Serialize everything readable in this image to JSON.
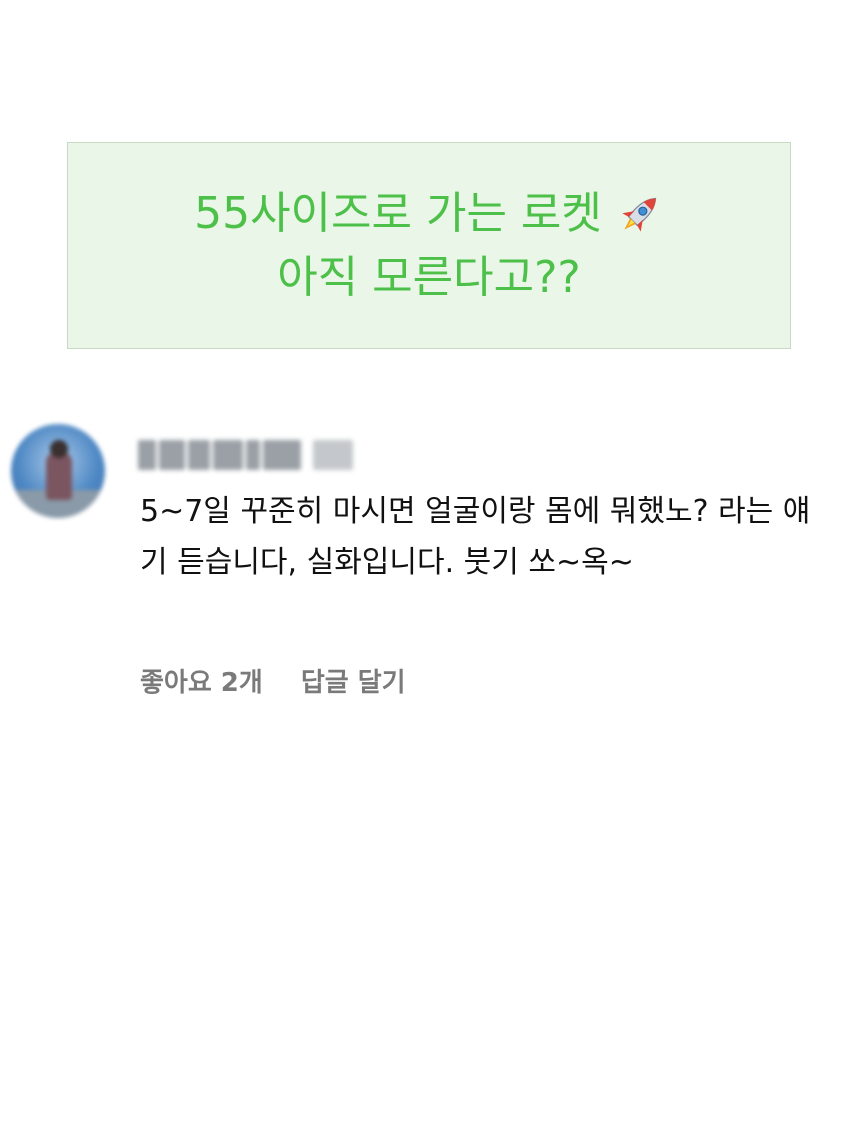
{
  "banner": {
    "line1": "55사이즈로 가는 로켓",
    "line2": "아직 모른다고??",
    "icon": "rocket-emoji",
    "text_color": "#4cc049",
    "background": "#eaf6e8"
  },
  "comment": {
    "body": "5~7일 꾸준히 마시면 얼굴이랑 몸에 뭐했노? 라는 얘기 듣습니다, 실화입니다. 붓기 쏘~옥~",
    "like_label": "좋아요 2개",
    "reply_label": "답글 달기"
  }
}
